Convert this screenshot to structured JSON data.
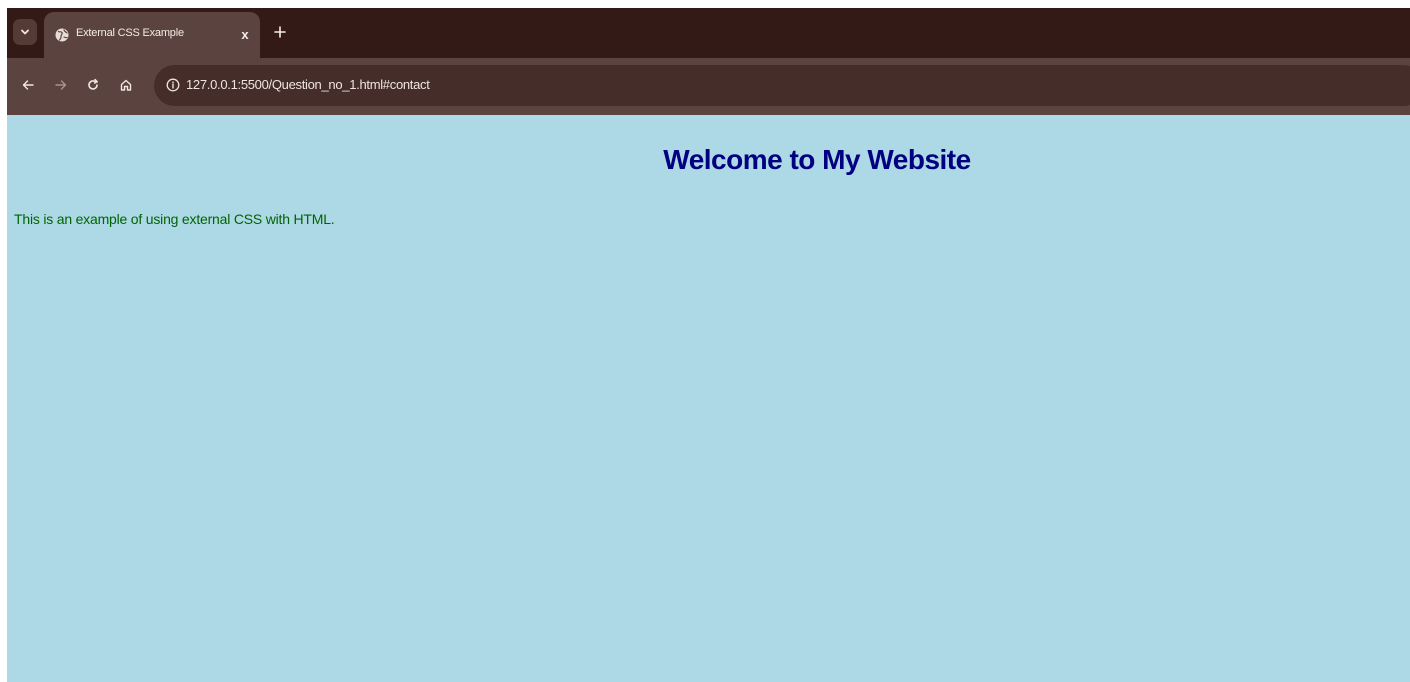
{
  "browser": {
    "tab": {
      "title": "External CSS Example",
      "close_label": "x"
    },
    "new_tab_label": "+",
    "address_bar": {
      "url": "127.0.0.1:5500/Question_no_1.html#contact"
    },
    "icons": {
      "tab_list": "chevron-down-icon",
      "favicon": "globe-icon",
      "back": "arrow-left-icon",
      "forward": "arrow-right-icon",
      "reload": "reload-icon",
      "home": "home-icon",
      "site_info": "info-icon"
    },
    "colors": {
      "tabstrip": "#331a16",
      "toolbar": "#5b4440",
      "omnibox": "#452d29"
    }
  },
  "page": {
    "heading": "Welcome to My Website",
    "paragraph": "This is an example of using external CSS with HTML.",
    "colors": {
      "background": "#add8e6",
      "heading": "#000080",
      "paragraph": "#006400"
    }
  }
}
